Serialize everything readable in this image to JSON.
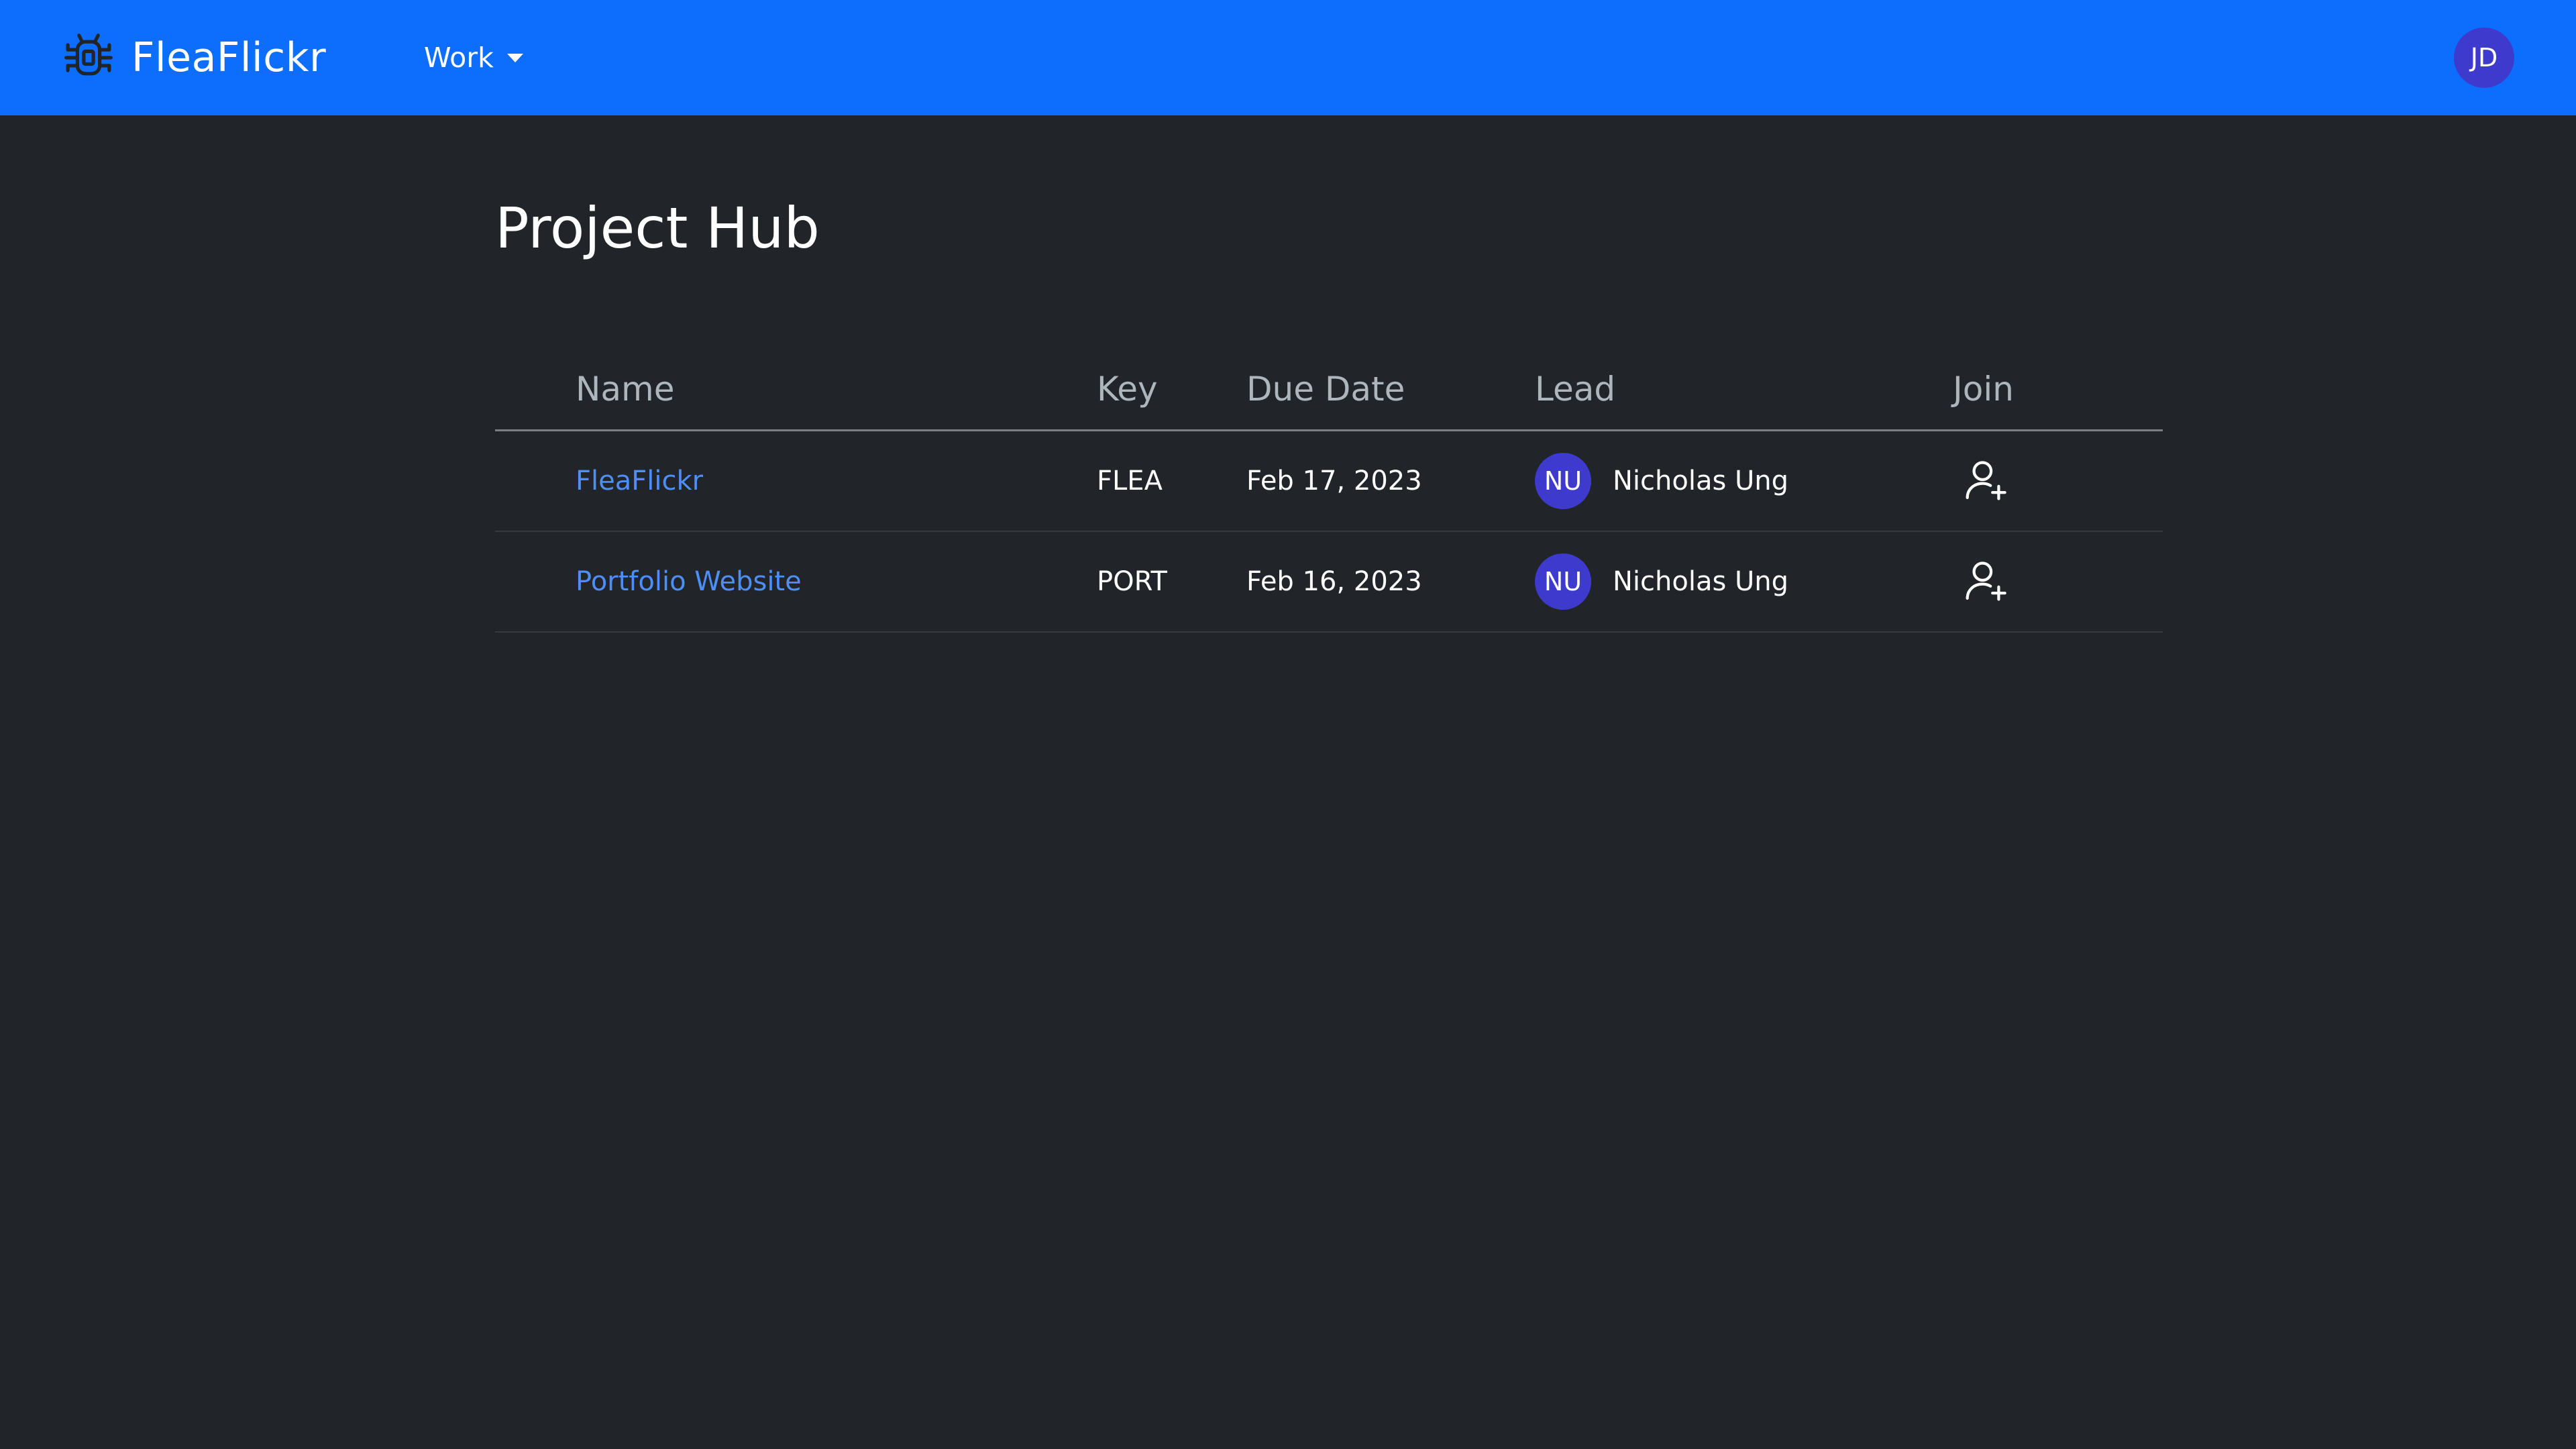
{
  "app": {
    "name": "FleaFlickr",
    "brand_icon": "bug-icon"
  },
  "navbar": {
    "dropdown_label": "Work",
    "dropdown_icon": "caret-down-icon",
    "user_initials": "JD",
    "accent_color": "#0d6efd"
  },
  "page": {
    "title": "Project Hub"
  },
  "table": {
    "headers": {
      "name": "Name",
      "key": "Key",
      "due_date": "Due Date",
      "lead": "Lead",
      "join": "Join"
    },
    "rows": [
      {
        "name": "FleaFlickr",
        "key": "FLEA",
        "due_date": "Feb 17, 2023",
        "lead_initials": "NU",
        "lead_name": "Nicholas Ung",
        "join_icon": "person-add-icon"
      },
      {
        "name": "Portfolio Website",
        "key": "PORT",
        "due_date": "Feb 16, 2023",
        "lead_initials": "NU",
        "lead_name": "Nicholas Ung",
        "join_icon": "person-add-icon"
      }
    ]
  },
  "colors": {
    "background": "#212529",
    "link": "#4d8ef7",
    "avatar": "#3d3acd",
    "header_text": "#adb5bd"
  }
}
